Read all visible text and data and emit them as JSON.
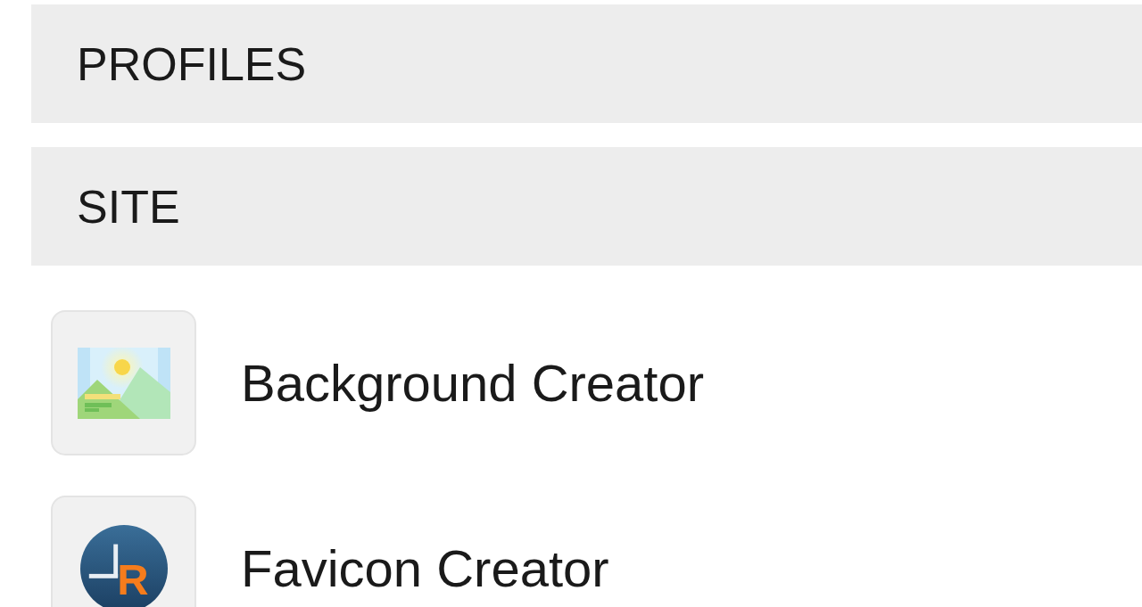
{
  "sections": [
    {
      "title": "PROFILES"
    },
    {
      "title": "SITE",
      "items": [
        {
          "label": "Background Creator",
          "kind": "image"
        },
        {
          "label": "Favicon Creator",
          "kind": "logo",
          "logo_text": "R"
        }
      ]
    }
  ]
}
